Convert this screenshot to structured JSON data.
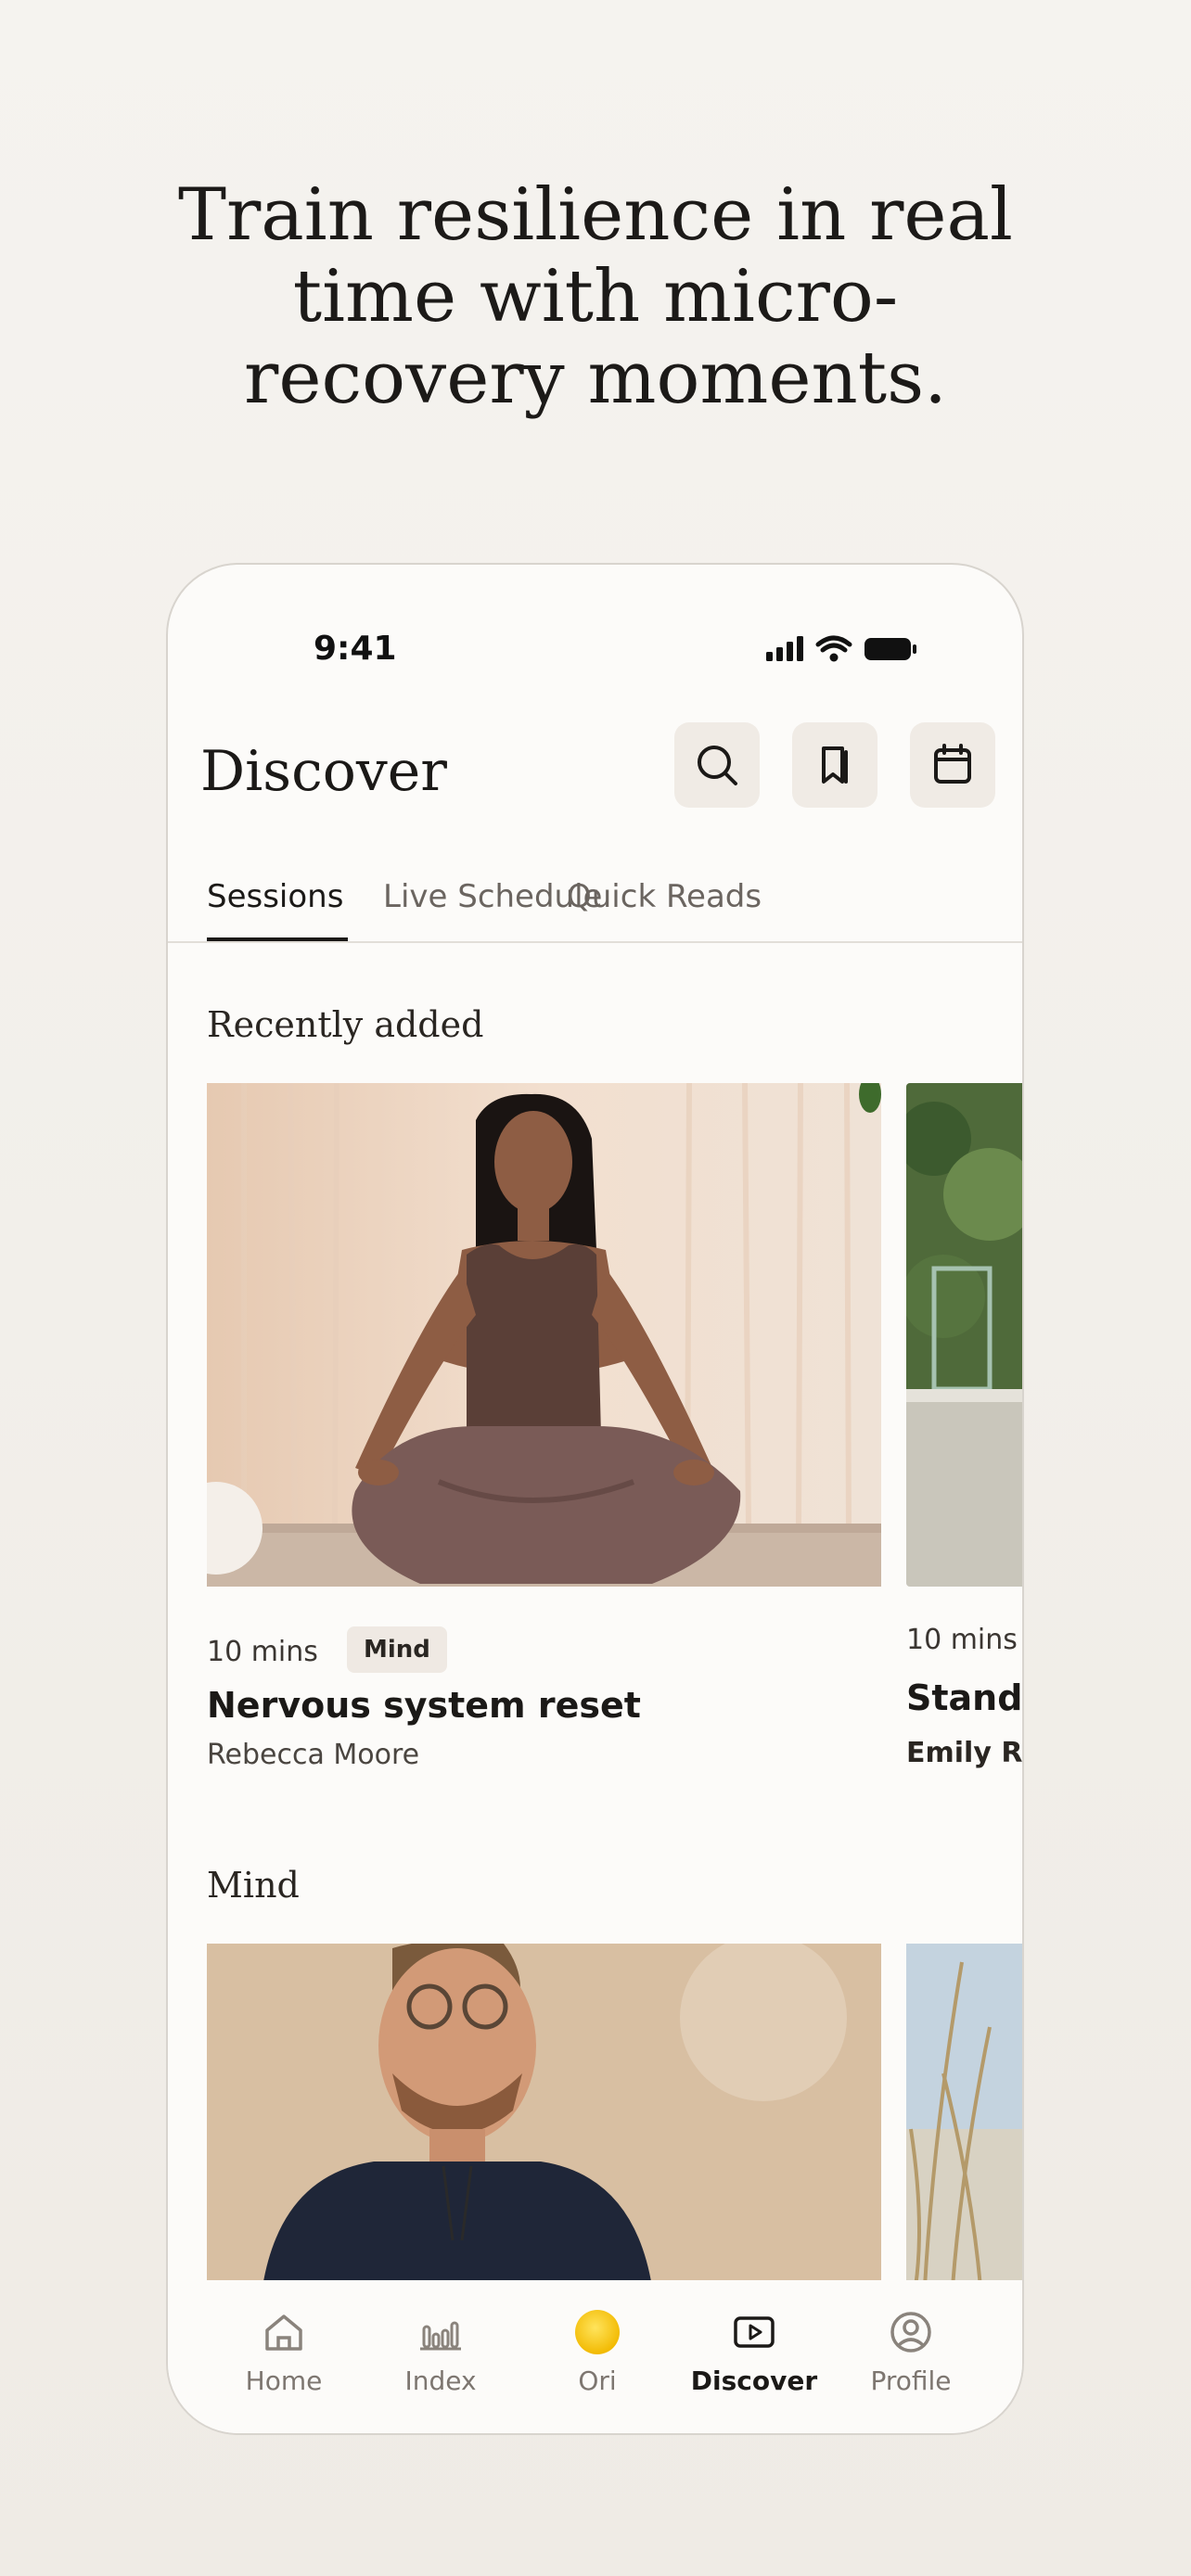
{
  "headline": {
    "line1": "Train resilience in real",
    "line2": "time with micro-",
    "line3": "recovery moments."
  },
  "status_bar": {
    "time": "9:41"
  },
  "header": {
    "title": "Discover",
    "icons": [
      "search-icon",
      "bookmark-icon",
      "calendar-icon"
    ]
  },
  "tabs": [
    {
      "label": "Sessions",
      "active": true
    },
    {
      "label": "Live Schedule",
      "active": false
    },
    {
      "label": "Quick Reads",
      "active": false
    }
  ],
  "sections": [
    {
      "title": "Recently added",
      "cards": [
        {
          "mins": "10 mins",
          "badge": "Mind",
          "title": "Nervous system reset",
          "author": "Rebecca Moore"
        },
        {
          "mins": "10 mins",
          "badge": "",
          "title": "Standi",
          "author": "Emily Ro"
        }
      ]
    },
    {
      "title": "Mind",
      "cards": []
    }
  ],
  "bottom_nav": [
    {
      "label": "Home",
      "icon": "home-icon",
      "active": false
    },
    {
      "label": "Index",
      "icon": "bar-chart-icon",
      "active": false
    },
    {
      "label": "Ori",
      "icon": "ori-sun-icon",
      "active": false
    },
    {
      "label": "Discover",
      "icon": "play-icon",
      "active": true
    },
    {
      "label": "Profile",
      "icon": "profile-icon",
      "active": false
    }
  ],
  "colors": {
    "accent_sun": "#f7c300",
    "background": "#f3f0eb",
    "text": "#1b1917"
  }
}
